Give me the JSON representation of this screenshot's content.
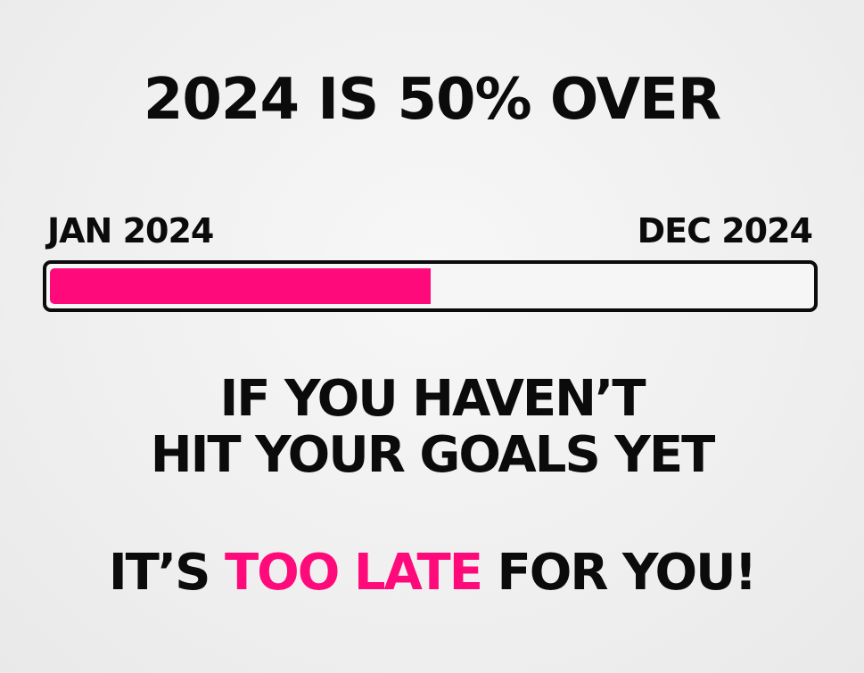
{
  "headline": "2024 IS 50% OVER",
  "progress": {
    "start_label": "JAN 2024",
    "end_label": "DEC 2024",
    "fraction": 0.5,
    "fill_color": "#ff0a7b",
    "track_color": "#f6f6f6",
    "border_color": "#0b0b0b"
  },
  "message": {
    "line1": "IF YOU HAVEN’T",
    "line2": "HIT YOUR GOALS YET",
    "line3_prefix": "IT’S ",
    "line3_highlight": "TOO LATE",
    "line3_suffix": " FOR YOU!",
    "highlight_color": "#ff0a7b"
  }
}
